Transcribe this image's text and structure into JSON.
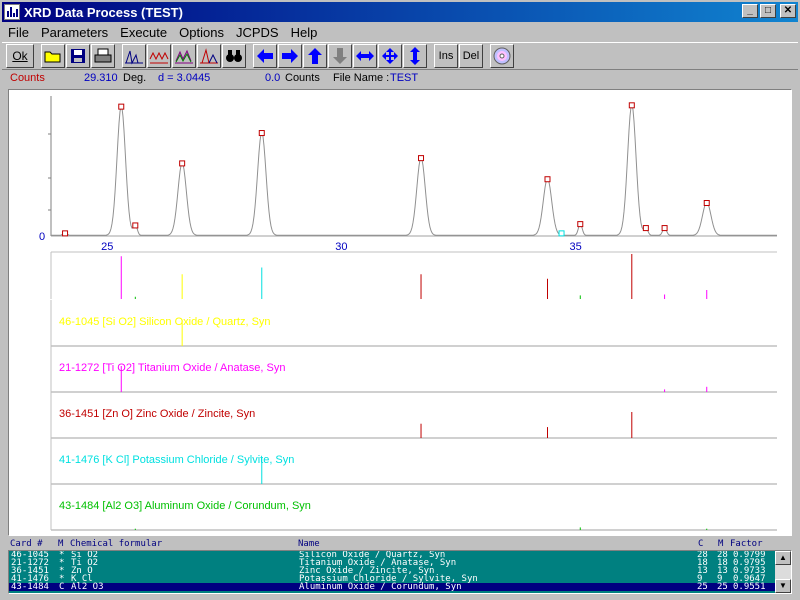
{
  "window": {
    "title": "XRD Data Process (TEST)",
    "controls": {
      "minimize": "_",
      "maximize": "□",
      "close": "✕"
    }
  },
  "menu": [
    "File",
    "Parameters",
    "Execute",
    "Options",
    "JCPDS",
    "Help"
  ],
  "toolbar": {
    "ok_label": "Ok",
    "ins_label": "Ins",
    "del_label": "Del",
    "icons": [
      "open-folder-icon",
      "save-disk-icon",
      "print-icon",
      "peak-chart-icon",
      "pattern-chart-icon",
      "smooth-chart-icon",
      "fit-chart-icon",
      "binoculars-icon",
      "arrow-left-icon",
      "arrow-right-icon",
      "arrow-up-icon",
      "arrow-down-icon",
      "expand-horizontal-icon",
      "expand-all-icon",
      "expand-vertical-icon",
      "cd-icon"
    ]
  },
  "status": {
    "counts_label": "Counts",
    "angle_value": "29.310",
    "angle_unit": "Deg.",
    "d_label": "d = 3.0445",
    "count_value": "0.0",
    "count_unit": "Counts",
    "file_label": "File Name :",
    "file_name": "TEST"
  },
  "colors": {
    "quartz": "#ffff00",
    "anatase": "#ff00ff",
    "zincite": "#c00000",
    "sylvite": "#00e0e0",
    "corundum": "#00c000",
    "marker": "#c00000",
    "axis_label": "#0000c0"
  },
  "chart_data": {
    "type": "line",
    "xlim": [
      23.8,
      39.3
    ],
    "xticks": [
      25,
      30,
      35
    ],
    "ytick_label": "0",
    "peaks": [
      {
        "x": 24.1,
        "y": 0.02
      },
      {
        "x": 25.3,
        "y": 0.98
      },
      {
        "x": 25.6,
        "y": 0.08
      },
      {
        "x": 26.6,
        "y": 0.55
      },
      {
        "x": 28.3,
        "y": 0.78
      },
      {
        "x": 31.7,
        "y": 0.59
      },
      {
        "x": 34.4,
        "y": 0.43
      },
      {
        "x": 35.1,
        "y": 0.09
      },
      {
        "x": 36.2,
        "y": 0.99
      },
      {
        "x": 36.5,
        "y": 0.06
      },
      {
        "x": 36.9,
        "y": 0.06
      },
      {
        "x": 37.8,
        "y": 0.25
      }
    ],
    "aux_marker": {
      "x": 34.7,
      "y": 0.02
    },
    "overlay_sticks": [
      {
        "x": 25.3,
        "h": 0.95,
        "phase": "anatase"
      },
      {
        "x": 25.6,
        "h": 0.05,
        "phase": "corundum"
      },
      {
        "x": 26.6,
        "h": 0.55,
        "phase": "quartz"
      },
      {
        "x": 28.3,
        "h": 0.7,
        "phase": "sylvite"
      },
      {
        "x": 31.7,
        "h": 0.55,
        "phase": "zincite"
      },
      {
        "x": 34.4,
        "h": 0.45,
        "phase": "zincite"
      },
      {
        "x": 35.1,
        "h": 0.08,
        "phase": "corundum"
      },
      {
        "x": 36.2,
        "h": 1.0,
        "phase": "zincite"
      },
      {
        "x": 36.9,
        "h": 0.1,
        "phase": "anatase"
      },
      {
        "x": 37.8,
        "h": 0.2,
        "phase": "anatase"
      }
    ],
    "reference_panels": [
      {
        "label": "46-1045 [Si O2] Silicon Oxide / Quartz, Syn",
        "phase": "quartz",
        "sticks": [
          {
            "x": 26.6,
            "h": 1.0
          }
        ]
      },
      {
        "label": "21-1272 [Ti O2] Titanium Oxide / Anatase, Syn",
        "phase": "anatase",
        "sticks": [
          {
            "x": 25.3,
            "h": 1.0
          },
          {
            "x": 36.9,
            "h": 0.1
          },
          {
            "x": 37.8,
            "h": 0.2
          }
        ]
      },
      {
        "label": "36-1451 [Zn O] Zinc Oxide / Zincite, Syn",
        "phase": "zincite",
        "sticks": [
          {
            "x": 31.7,
            "h": 0.55
          },
          {
            "x": 34.4,
            "h": 0.42
          },
          {
            "x": 36.2,
            "h": 1.0
          }
        ]
      },
      {
        "label": "41-1476 [K Cl] Potassium Chloride / Sylvite, Syn",
        "phase": "sylvite",
        "sticks": [
          {
            "x": 28.3,
            "h": 1.0
          }
        ]
      },
      {
        "label": "43-1484 [Al2 O3] Aluminum Oxide / Corundum, Syn",
        "phase": "corundum",
        "sticks": [
          {
            "x": 25.6,
            "h": 0.05
          },
          {
            "x": 35.1,
            "h": 0.1
          },
          {
            "x": 37.8,
            "h": 0.05
          }
        ]
      }
    ]
  },
  "list": {
    "headers": {
      "card": "Card #",
      "m": "M",
      "formula": "Chemical formular",
      "name": "Name",
      "c": "C",
      "m2": "M",
      "factor": "Factor"
    },
    "rows": [
      {
        "card": "46-1045",
        "mark": "*",
        "formula": "Si O2",
        "name": "Silicon Oxide / Quartz, Syn",
        "c": "28",
        "m": "28",
        "factor": "0.9799"
      },
      {
        "card": "21-1272",
        "mark": "*",
        "formula": "Ti O2",
        "name": "Titanium Oxide / Anatase, Syn",
        "c": "18",
        "m": "18",
        "factor": "0.9795"
      },
      {
        "card": "36-1451",
        "mark": "*",
        "formula": "Zn O",
        "name": "Zinc Oxide / Zincite, Syn",
        "c": "13",
        "m": "13",
        "factor": "0.9733"
      },
      {
        "card": "41-1476",
        "mark": "*",
        "formula": "K Cl",
        "name": "Potassium Chloride / Sylvite, Syn",
        "c": "9",
        "m": "9",
        "factor": "0.9647"
      },
      {
        "card": "43-1484",
        "mark": "C",
        "formula": "Al2 O3",
        "name": "Aluminum Oxide / Corundum, Syn",
        "c": "25",
        "m": "25",
        "factor": "0.9551"
      }
    ],
    "selected_index": 4
  }
}
